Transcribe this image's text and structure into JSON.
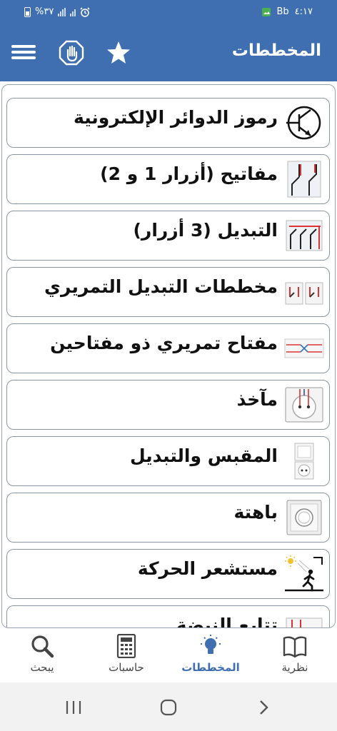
{
  "status_bar": {
    "time": "٤:١٧",
    "carrier": "Bb",
    "battery": "%٣٧"
  },
  "app_bar": {
    "title": "المخططات",
    "icons": [
      "hamburger-menu-icon",
      "stop-hand-icon",
      "star-icon"
    ]
  },
  "list": {
    "items": [
      {
        "label": "رموز الدوائر الإلكترونية",
        "icon": "transistor-symbol-icon"
      },
      {
        "label": "مفاتيح (أزرار 1 و 2)",
        "icon": "switch-1-2-gang-icon"
      },
      {
        "label": "التبديل (3 أزرار)",
        "icon": "switch-3-gang-icon"
      },
      {
        "label": "مخططات التبديل التمريري",
        "icon": "two-way-switch-icon"
      },
      {
        "label": "مفتاح تمريري ذو مفتاحين",
        "icon": "double-two-way-switch-icon"
      },
      {
        "label": "مآخذ",
        "icon": "socket-icon"
      },
      {
        "label": "المقبس والتبديل",
        "icon": "socket-and-switch-icon"
      },
      {
        "label": "باهتة",
        "icon": "dimmer-icon"
      },
      {
        "label": "مستشعر الحركة",
        "icon": "motion-sensor-icon"
      },
      {
        "label": "تتابع النبضة",
        "icon": "pulse-relay-icon"
      }
    ]
  },
  "bottom_nav": {
    "items": [
      {
        "label": "يبحث",
        "icon": "search-icon"
      },
      {
        "label": "حاسبات",
        "icon": "calculator-icon"
      },
      {
        "label": "المخططات",
        "icon": "lightbulb-icon",
        "active": true
      },
      {
        "label": "نظرية",
        "icon": "book-icon"
      }
    ]
  },
  "colors": {
    "primary": "#3f6fb0",
    "item_border": "#8c96a0",
    "text": "#111111"
  }
}
